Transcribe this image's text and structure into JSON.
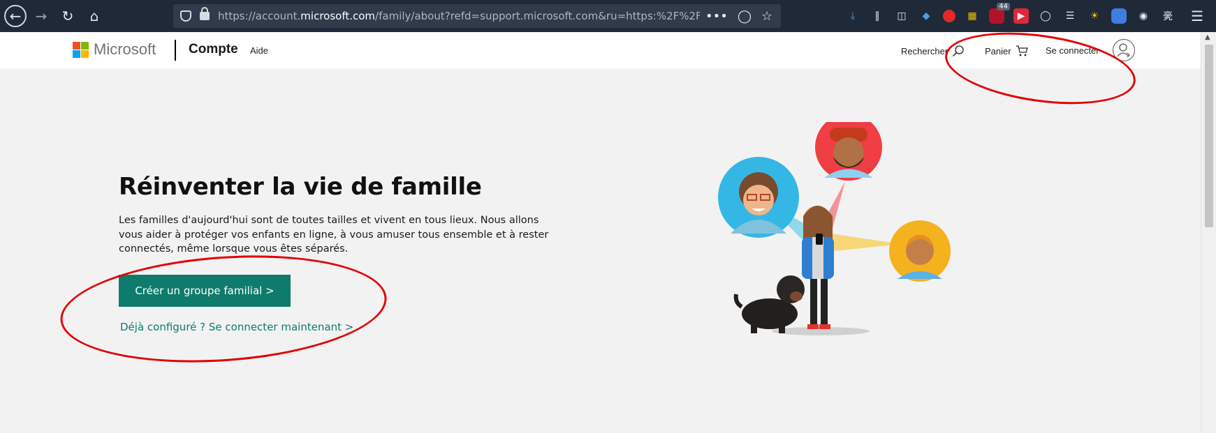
{
  "browser": {
    "url_prefix": "https://account.",
    "url_domain": "microsoft.com",
    "url_rest": "/family/about?refd=support.microsoft.com&ru=https:%2F%2Faccount.micr",
    "more_glyph": "•••",
    "extension_badge": "44"
  },
  "header": {
    "brand": "Microsoft",
    "section": "Compte",
    "help": "Aide",
    "search_label": "Rechercher",
    "cart_label": "Panier",
    "signin_label": "Se connecter",
    "logo_colors": [
      "#f25022",
      "#7fba00",
      "#00a4ef",
      "#ffb900"
    ]
  },
  "hero": {
    "title": "Réinventer la vie de famille",
    "description": "Les familles d'aujourd'hui sont de toutes tailles et vivent en tous lieux. Nous allons vous aider à protéger vos enfants en ligne, à vous amuser tous ensemble et à rester connectés, même lorsque vous êtes séparés.",
    "cta_button": "Créer un groupe familial >",
    "signin_link": "Déjà configuré ? Se connecter maintenant >"
  },
  "colors": {
    "accent": "#0f7b6c",
    "annotation": "#e30000"
  }
}
